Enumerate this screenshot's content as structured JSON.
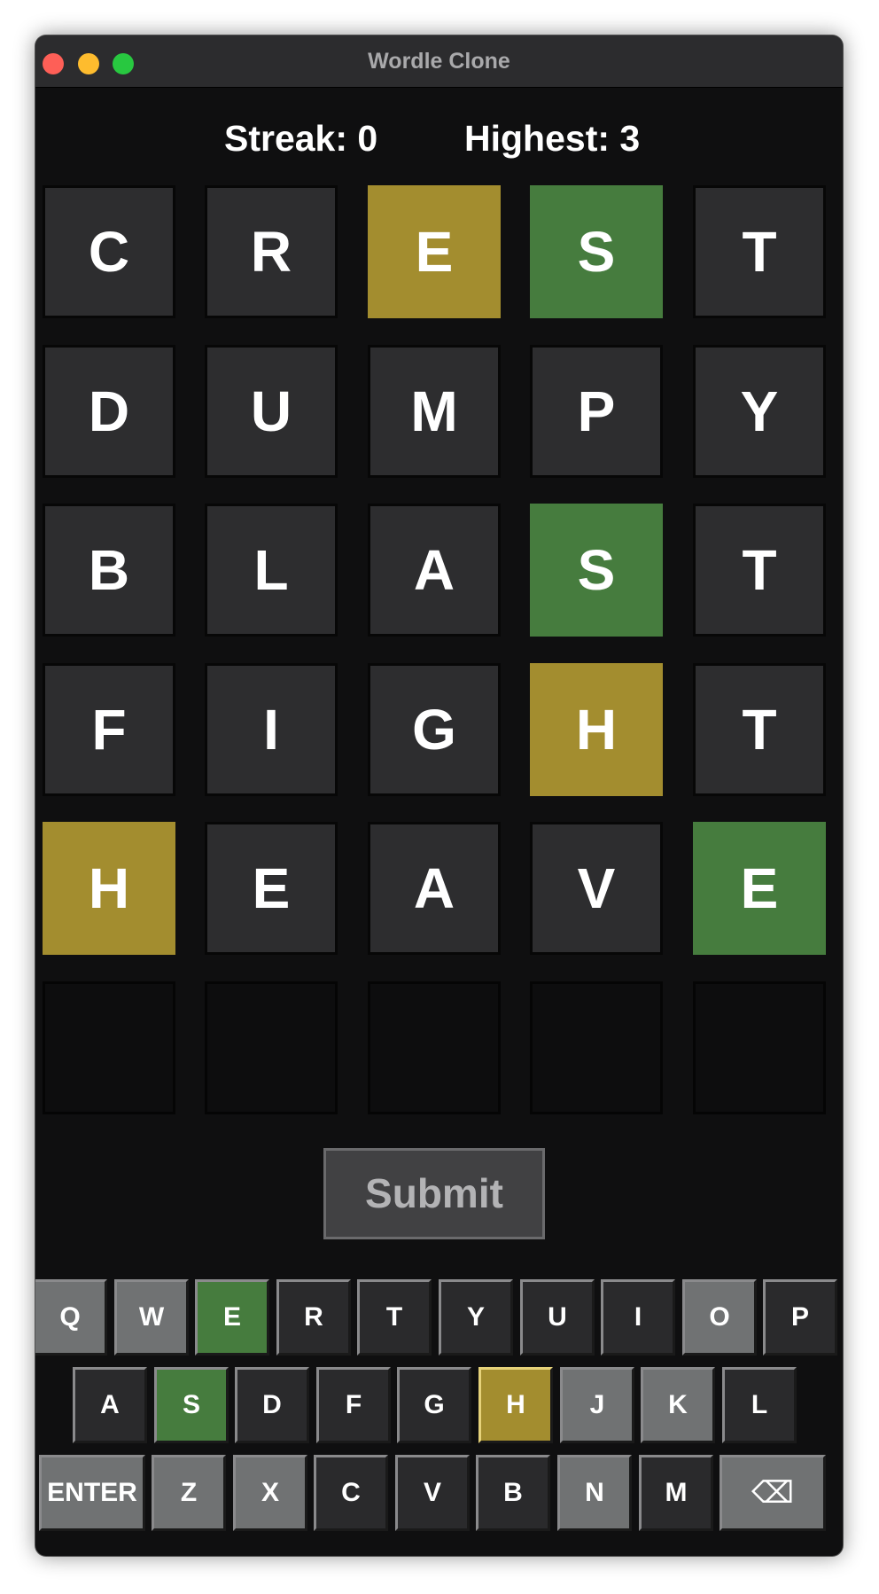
{
  "window": {
    "title": "Wordle Clone"
  },
  "stats": {
    "streak": "Streak: 0",
    "highest": "Highest: 3"
  },
  "board": {
    "rows": [
      [
        {
          "letter": "C",
          "state": "absent"
        },
        {
          "letter": "R",
          "state": "absent"
        },
        {
          "letter": "E",
          "state": "present"
        },
        {
          "letter": "S",
          "state": "correct"
        },
        {
          "letter": "T",
          "state": "absent"
        }
      ],
      [
        {
          "letter": "D",
          "state": "absent"
        },
        {
          "letter": "U",
          "state": "absent"
        },
        {
          "letter": "M",
          "state": "absent"
        },
        {
          "letter": "P",
          "state": "absent"
        },
        {
          "letter": "Y",
          "state": "absent"
        }
      ],
      [
        {
          "letter": "B",
          "state": "absent"
        },
        {
          "letter": "L",
          "state": "absent"
        },
        {
          "letter": "A",
          "state": "absent"
        },
        {
          "letter": "S",
          "state": "correct"
        },
        {
          "letter": "T",
          "state": "absent"
        }
      ],
      [
        {
          "letter": "F",
          "state": "absent"
        },
        {
          "letter": "I",
          "state": "absent"
        },
        {
          "letter": "G",
          "state": "absent"
        },
        {
          "letter": "H",
          "state": "present"
        },
        {
          "letter": "T",
          "state": "absent"
        }
      ],
      [
        {
          "letter": "H",
          "state": "present"
        },
        {
          "letter": "E",
          "state": "absent"
        },
        {
          "letter": "A",
          "state": "absent"
        },
        {
          "letter": "V",
          "state": "absent"
        },
        {
          "letter": "E",
          "state": "correct"
        }
      ],
      [
        {
          "letter": "",
          "state": "empty"
        },
        {
          "letter": "",
          "state": "empty"
        },
        {
          "letter": "",
          "state": "empty"
        },
        {
          "letter": "",
          "state": "empty"
        },
        {
          "letter": "",
          "state": "empty"
        }
      ]
    ]
  },
  "submit_label": "Submit",
  "keyboard": {
    "rows": [
      [
        {
          "label": "Q",
          "state": "unused"
        },
        {
          "label": "W",
          "state": "unused"
        },
        {
          "label": "E",
          "state": "correct"
        },
        {
          "label": "R",
          "state": "absent"
        },
        {
          "label": "T",
          "state": "absent"
        },
        {
          "label": "Y",
          "state": "absent"
        },
        {
          "label": "U",
          "state": "absent"
        },
        {
          "label": "I",
          "state": "absent"
        },
        {
          "label": "O",
          "state": "unused"
        },
        {
          "label": "P",
          "state": "absent"
        }
      ],
      [
        {
          "label": "A",
          "state": "absent"
        },
        {
          "label": "S",
          "state": "correct"
        },
        {
          "label": "D",
          "state": "absent"
        },
        {
          "label": "F",
          "state": "absent"
        },
        {
          "label": "G",
          "state": "absent"
        },
        {
          "label": "H",
          "state": "present"
        },
        {
          "label": "J",
          "state": "unused"
        },
        {
          "label": "K",
          "state": "unused"
        },
        {
          "label": "L",
          "state": "absent"
        }
      ],
      [
        {
          "label": "ENTER",
          "state": "action"
        },
        {
          "label": "Z",
          "state": "unused"
        },
        {
          "label": "X",
          "state": "unused"
        },
        {
          "label": "C",
          "state": "absent"
        },
        {
          "label": "V",
          "state": "absent"
        },
        {
          "label": "B",
          "state": "absent"
        },
        {
          "label": "N",
          "state": "unused"
        },
        {
          "label": "M",
          "state": "absent"
        },
        {
          "label": "⌫",
          "state": "action",
          "icon": "backspace-icon"
        }
      ]
    ]
  },
  "colors": {
    "correct": "#467c3e",
    "present": "#a38d2f",
    "absent": "#2d2d2f",
    "unused": "#707273",
    "background": "#0f0f10"
  }
}
